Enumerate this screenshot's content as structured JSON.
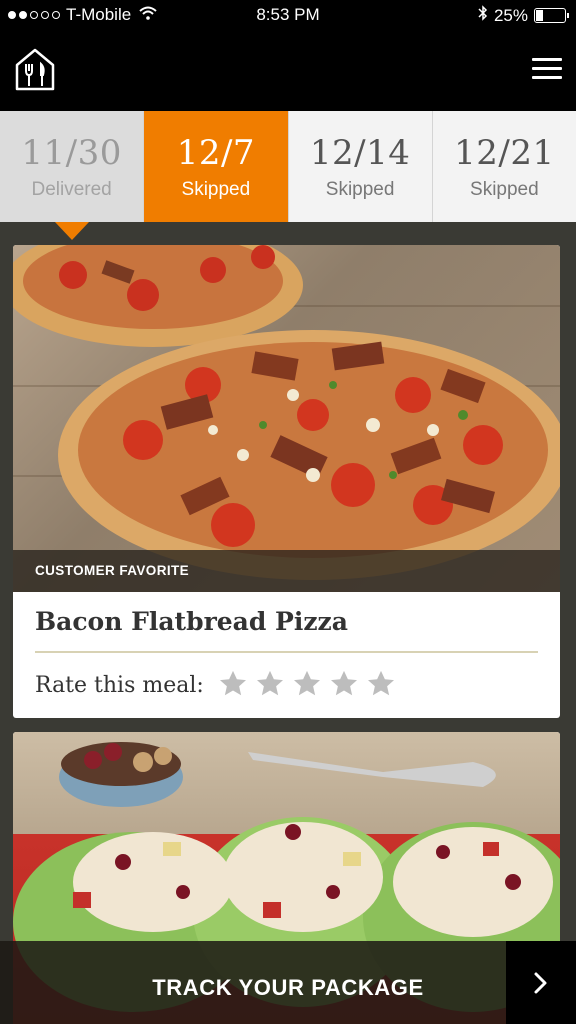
{
  "status_bar": {
    "carrier": "T-Mobile",
    "time": "8:53 PM",
    "battery": "25%",
    "battery_level": 0.25,
    "signal_bars": 2
  },
  "header": {
    "logo_icon": "home-fork-knife-icon",
    "menu_icon": "hamburger-menu-icon"
  },
  "weeks": [
    {
      "date": "11/30",
      "status": "Delivered",
      "state": "delivered"
    },
    {
      "date": "12/7",
      "status": "Skipped",
      "state": "active"
    },
    {
      "date": "12/14",
      "status": "Skipped",
      "state": "normal"
    },
    {
      "date": "12/21",
      "status": "Skipped",
      "state": "normal"
    }
  ],
  "meals": [
    {
      "tag": "CUSTOMER FAVORITE",
      "title": "Bacon Flatbread Pizza",
      "rate_label": "Rate this meal:",
      "rating": 0,
      "max_rating": 5
    }
  ],
  "track": {
    "label": "TRACK YOUR PACKAGE",
    "arrow_icon": "chevron-right-icon"
  },
  "colors": {
    "accent": "#f07d00",
    "background": "#3a3a34",
    "star_empty": "#bdbdbd"
  }
}
